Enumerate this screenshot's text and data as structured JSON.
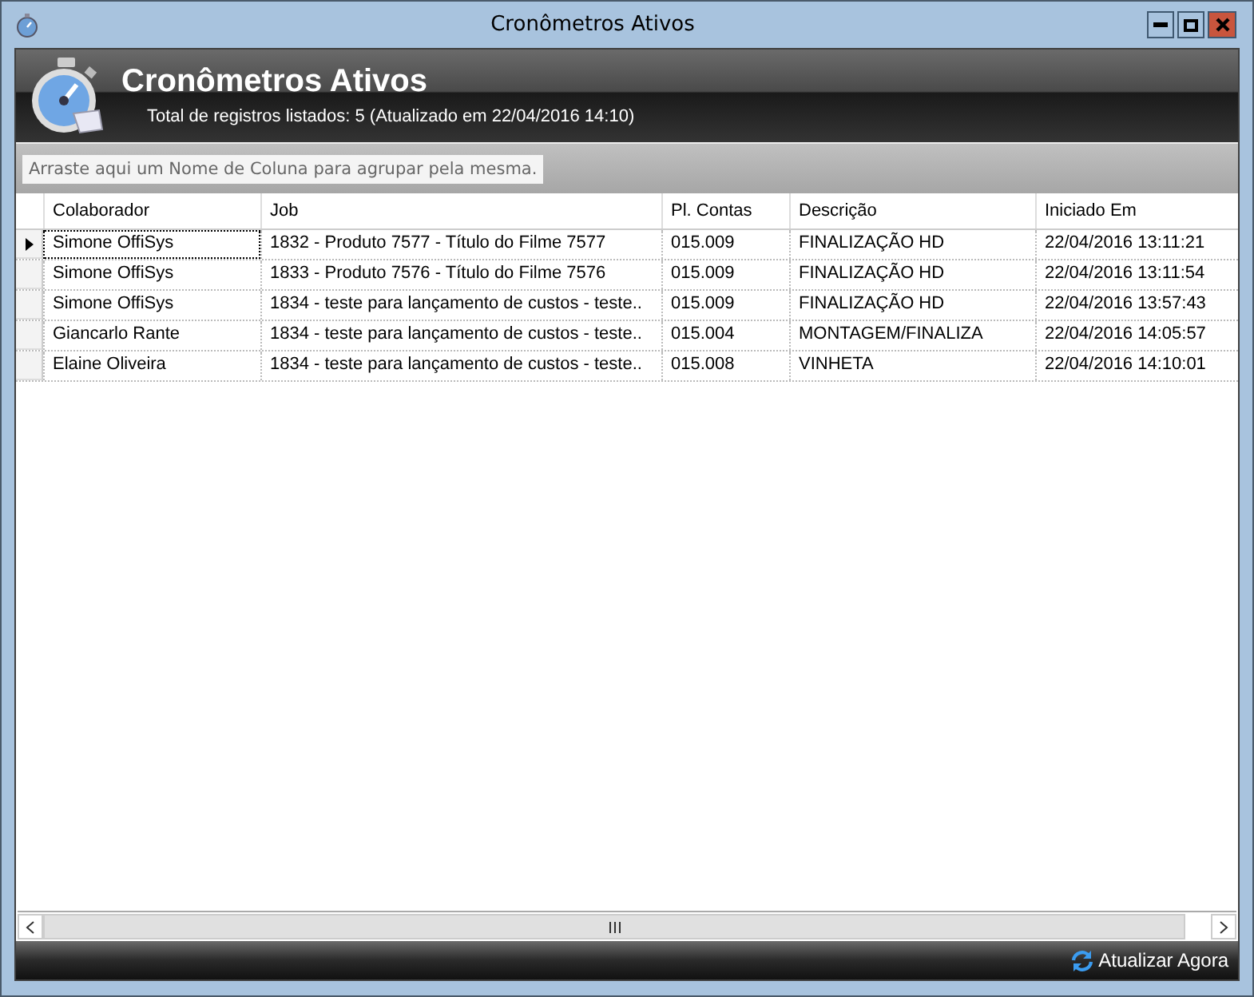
{
  "window": {
    "title": "Cronômetros Ativos"
  },
  "header": {
    "title": "Cronômetros Ativos",
    "subtitle": "Total de registros listados: 5 (Atualizado em 22/04/2016 14:10)"
  },
  "group_panel": {
    "placeholder": "Arraste aqui um Nome de Coluna para agrupar pela mesma."
  },
  "table": {
    "columns": [
      "Colaborador",
      "Job",
      "Pl. Contas",
      "Descrição",
      "Iniciado Em"
    ],
    "rows": [
      {
        "selected": true,
        "cells": [
          "Simone OffiSys",
          "1832 - Produto 7577 - Título do Filme 7577",
          "015.009",
          "FINALIZAÇÃO HD",
          "22/04/2016 13:11:21"
        ]
      },
      {
        "selected": false,
        "cells": [
          "Simone OffiSys",
          "1833 - Produto 7576 - Título do Filme 7576",
          "015.009",
          "FINALIZAÇÃO HD",
          "22/04/2016 13:11:54"
        ]
      },
      {
        "selected": false,
        "cells": [
          "Simone OffiSys",
          "1834  - teste para lançamento de custos  - teste..",
          "015.009",
          "FINALIZAÇÃO HD",
          "22/04/2016 13:57:43"
        ]
      },
      {
        "selected": false,
        "cells": [
          "Giancarlo Rante",
          "1834  - teste para lançamento de custos  - teste..",
          "015.004",
          "MONTAGEM/FINALIZA",
          "22/04/2016 14:05:57"
        ]
      },
      {
        "selected": false,
        "cells": [
          "Elaine Oliveira",
          "1834  - teste para lançamento de custos  - teste..",
          "015.008",
          "VINHETA",
          "22/04/2016 14:10:01"
        ]
      }
    ]
  },
  "footer": {
    "button": "Atualizar Agora"
  }
}
